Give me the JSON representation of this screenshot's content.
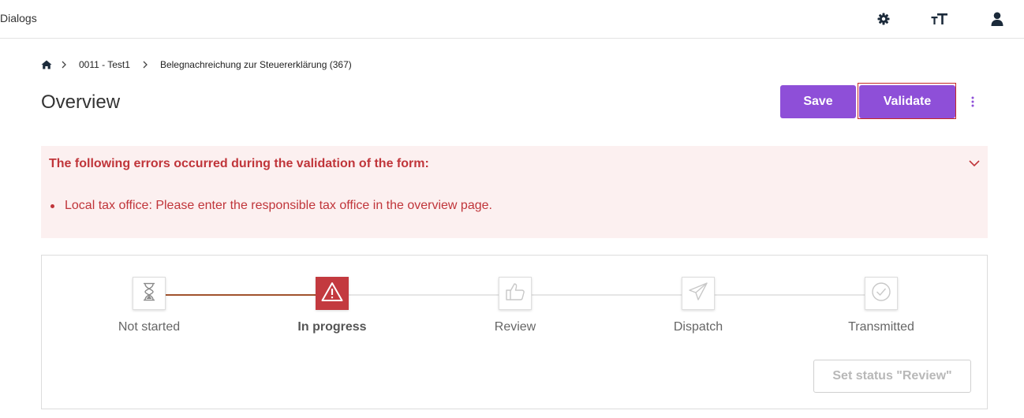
{
  "app": {
    "title": "Dialogs"
  },
  "header": {
    "icons": [
      "gear-icon",
      "text-size-icon",
      "user-icon"
    ]
  },
  "breadcrumb": {
    "items": [
      "0011 - Test1",
      "Belegnachreichung zur Steuererklärung (367)"
    ]
  },
  "page": {
    "title": "Overview"
  },
  "actions": {
    "save_label": "Save",
    "validate_label": "Validate"
  },
  "errors": {
    "title": "The following errors occurred during the validation of the form:",
    "items": [
      "Local tax office: Please enter the responsible tax office in the overview page."
    ]
  },
  "status": {
    "steps": [
      {
        "label": "Not started",
        "icon": "hourglass-icon",
        "state": "done"
      },
      {
        "label": "In progress",
        "icon": "warning-icon",
        "state": "current"
      },
      {
        "label": "Review",
        "icon": "thumbs-up-icon",
        "state": "pending"
      },
      {
        "label": "Dispatch",
        "icon": "paper-plane-icon",
        "state": "pending"
      },
      {
        "label": "Transmitted",
        "icon": "check-circle-icon",
        "state": "pending"
      }
    ],
    "set_status_label": "Set status \"Review\""
  },
  "colors": {
    "accent": "#8e4fd8",
    "error_text": "#c0353a",
    "error_bg": "#fcf0f0",
    "current_step": "#c33a3f",
    "progress_line": "#a0522d"
  }
}
